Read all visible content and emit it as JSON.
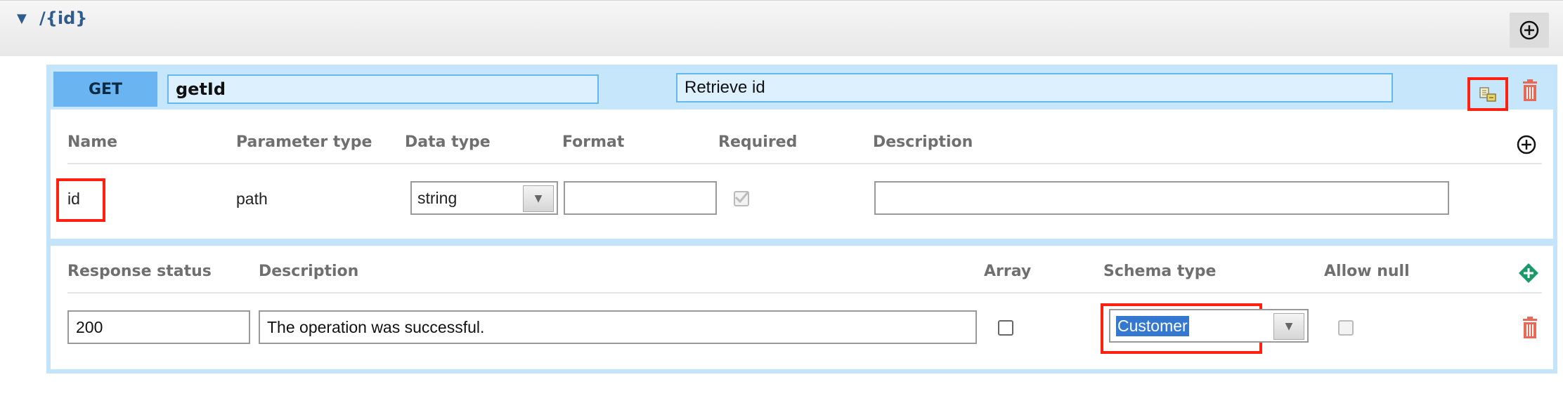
{
  "resource": {
    "collapse_icon": "caret-down-icon",
    "path": "/{id}",
    "add_icon": "circle-plus-icon"
  },
  "operation": {
    "method": "GET",
    "operation_id": "getId",
    "summary": "Retrieve id",
    "generate_icon": "generate-code-icon",
    "delete_icon": "trash-icon"
  },
  "parameters": {
    "headers": {
      "name": "Name",
      "parameter_type": "Parameter type",
      "data_type": "Data type",
      "format": "Format",
      "required": "Required",
      "description": "Description"
    },
    "rows": [
      {
        "name": "id",
        "parameter_type": "path",
        "data_type": "string",
        "format": "",
        "required": true,
        "description": ""
      }
    ]
  },
  "responses": {
    "headers": {
      "status": "Response status",
      "description": "Description",
      "array": "Array",
      "schema_type": "Schema type",
      "allow_null": "Allow null"
    },
    "rows": [
      {
        "status": "200",
        "description": "The operation was successful.",
        "array": false,
        "schema_type": "Customer",
        "allow_null": false
      }
    ]
  },
  "colors": {
    "accent_blue": "#6bb4f2",
    "panel_blue": "#c6e6fc",
    "highlight_red": "#ff2010",
    "add_green": "#1a9a6a",
    "delete_red": "#e66a55"
  }
}
